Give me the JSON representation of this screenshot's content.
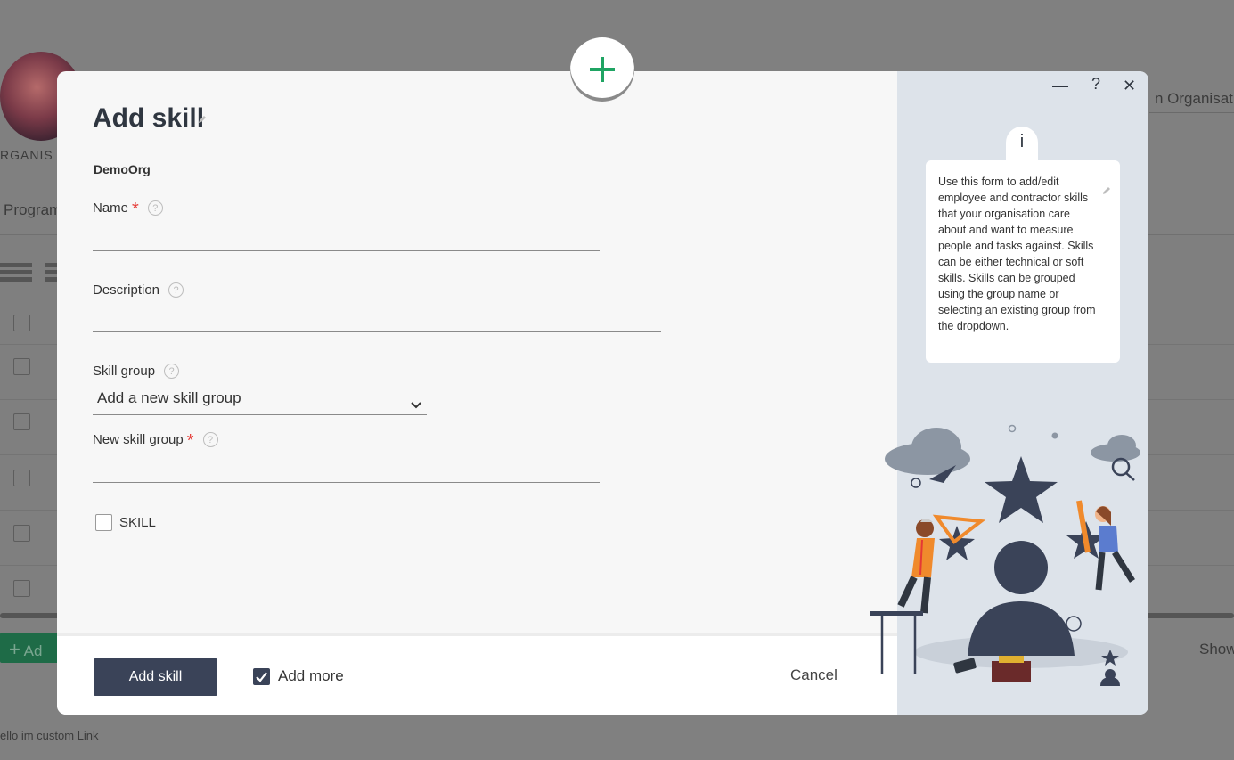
{
  "background": {
    "org_label": "RGANIS",
    "nav_item": "Program",
    "right_field": "n Organisatio",
    "add_button": "Ad",
    "show_label": "Show",
    "footer_link": "ello im custom Link"
  },
  "modal": {
    "title": "Add skill",
    "org_name": "DemoOrg",
    "fields": {
      "name": {
        "label": "Name",
        "value": ""
      },
      "description": {
        "label": "Description",
        "value": ""
      },
      "skill_group": {
        "label": "Skill group",
        "selected": "Add a new skill group"
      },
      "new_skill_group": {
        "label": "New skill group",
        "value": ""
      },
      "skill_checkbox": {
        "label": "SKILL",
        "checked": false
      }
    },
    "footer": {
      "submit_label": "Add skill",
      "add_more_label": "Add more",
      "add_more_checked": true,
      "cancel_label": "Cancel"
    },
    "side_panel": {
      "info_icon": "i",
      "info_text": "Use this form to add/edit employee and contractor skills that your organisation care about and want to measure people and tasks against. Skills can be either technical or soft skills. Skills can be grouped using the group name or selecting an existing group from the dropdown.",
      "minimize_icon": "—",
      "help_icon": "?",
      "close_icon": "✕"
    }
  },
  "colors": {
    "primary": "#3a4358",
    "accent_green": "#1fa463",
    "required": "#e53935",
    "side_bg": "#dde3ea"
  }
}
